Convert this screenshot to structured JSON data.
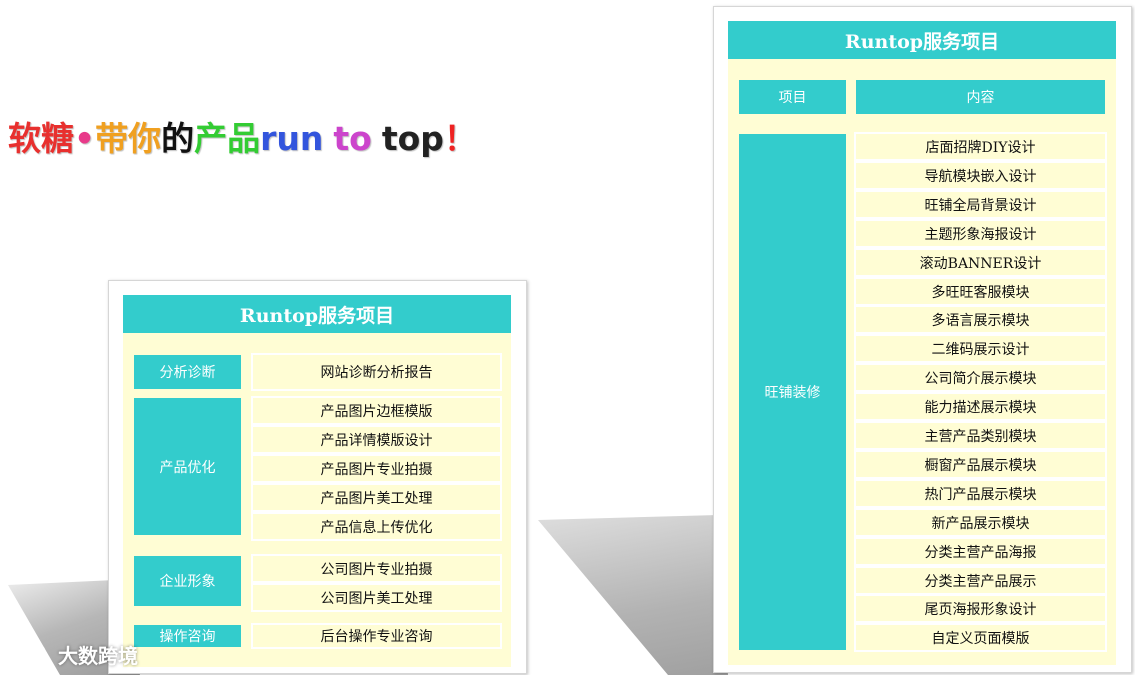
{
  "headline": {
    "segments": [
      {
        "text": "软糖",
        "color": "#e8302e"
      },
      {
        "text": "•",
        "color": "#e83a8a"
      },
      {
        "text": "带你",
        "color": "#f0a020"
      },
      {
        "text": "的",
        "color": "#111111"
      },
      {
        "text": "产品",
        "color": "#33cc33"
      },
      {
        "text": "run",
        "color": "#3355dd"
      },
      {
        "text": " ",
        "color": "#111111"
      },
      {
        "text": "to",
        "color": "#cc44cc"
      },
      {
        "text": " ",
        "color": "#111111"
      },
      {
        "text": "top",
        "color": "#222222"
      },
      {
        "text": "！",
        "color": "#ee2222"
      }
    ]
  },
  "left_card": {
    "title": "Runtop服务项目",
    "groups": [
      {
        "category": "分析诊断",
        "items": [
          "网站诊断分析报告"
        ]
      },
      {
        "category": "产品优化",
        "items": [
          "产品图片边框模版",
          "产品详情模版设计",
          "产品图片专业拍摄",
          "产品图片美工处理",
          "产品信息上传优化"
        ]
      },
      {
        "category": "企业形象",
        "items": [
          "公司图片专业拍摄",
          "公司图片美工处理"
        ]
      },
      {
        "category": "操作咨询",
        "items": [
          "后台操作专业咨询"
        ]
      }
    ]
  },
  "right_card": {
    "title": "Runtop服务项目",
    "header": {
      "col1": "项目",
      "col2": "内容"
    },
    "category": "旺铺装修",
    "items": [
      "店面招牌DIY设计",
      "导航模块嵌入设计",
      "旺铺全局背景设计",
      "主题形象海报设计",
      "滚动BANNER设计",
      "多旺旺客服模块",
      "多语言展示模块",
      "二维码展示设计",
      "公司简介展示模块",
      "能力描述展示模块",
      "主营产品类别模块",
      "橱窗产品展示模块",
      "热门产品展示模块",
      "新产品展示模块",
      "分类主营产品海报",
      "分类主营产品展示",
      "尾页海报形象设计",
      "自定义页面模版"
    ]
  },
  "watermark": {
    "text": "大数跨境"
  },
  "colors": {
    "accent": "#33cccc",
    "cell_bg": "#fffdd4"
  }
}
